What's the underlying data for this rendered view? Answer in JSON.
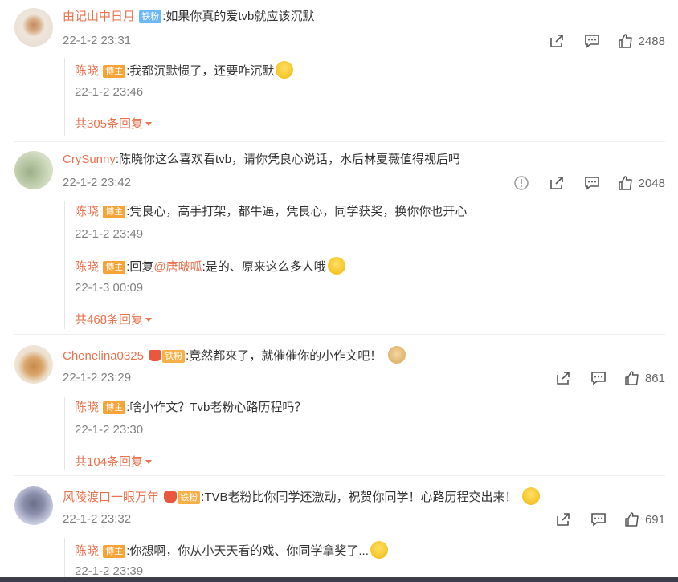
{
  "comments": [
    {
      "user": "由记山中日月",
      "badge": "铁粉",
      "text": ":如果你真的爱tvb就应该沉默",
      "time": "22-1-2 23:31",
      "likes": "2488",
      "replies": [
        {
          "user": "陈晓",
          "badge": "博主",
          "text": ":我都沉默惯了，还要咋沉默",
          "time": "22-1-2 23:46"
        }
      ],
      "more": "共305条回复"
    },
    {
      "user": "CrySunny",
      "text": ":陈晓你这么喜欢看tvb，请你凭良心说话，水后林夏薇值得视后吗",
      "time": "22-1-2 23:42",
      "likes": "2048",
      "replies": [
        {
          "user": "陈晓",
          "badge": "博主",
          "text": ":凭良心，高手打架，都牛逼，凭良心，同学获奖，换你你也开心",
          "time": "22-1-2 23:49"
        },
        {
          "user": "陈晓",
          "badge": "博主",
          "prefix": ":回复",
          "mention": "@唐啵呱",
          "text": ":是的、原来这么多人哦",
          "time": "22-1-3 00:09"
        }
      ],
      "more": "共468条回复"
    },
    {
      "user": "Chenelina0325",
      "badge": "铁粉",
      "text": ":竟然都來了，就催催你的小作文吧！",
      "time": "22-1-2 23:29",
      "likes": "861",
      "replies": [
        {
          "user": "陈晓",
          "badge": "博主",
          "text": ":啥小作文？Tvb老粉心路历程吗？",
          "time": "22-1-2 23:30"
        }
      ],
      "more": "共104条回复"
    },
    {
      "user": "风陵渡口一眼万年",
      "badge": "铁粉",
      "text": ":TVB老粉比你同学还激动，祝贺你同学！心路历程交出来！",
      "time": "22-1-2 23:32",
      "likes": "691",
      "replies": [
        {
          "user": "陈晓",
          "badge": "博主",
          "text": ":你想啊，你从小天天看的戏、你同学拿奖了...",
          "time": "22-1-2 23:39"
        }
      ]
    }
  ],
  "icons": {
    "report": "report-icon",
    "share": "share-icon",
    "comment": "comment-icon",
    "like": "like-icon"
  },
  "colors": {
    "username": "#eb7350",
    "badge_tie": "#6cb7f5",
    "badge_host": "#f7a335",
    "timestamp": "#808080"
  }
}
